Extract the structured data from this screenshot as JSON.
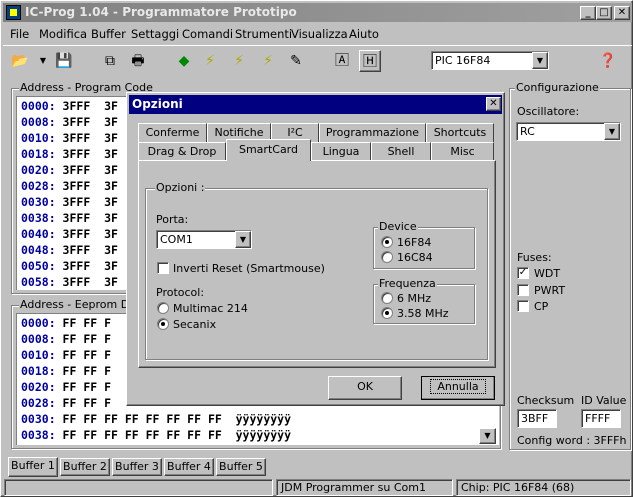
{
  "window": {
    "title": "IC-Prog 1.04 - Programmatore Prototipo"
  },
  "menu": [
    "File",
    "Modifica",
    "Buffer",
    "Settaggi",
    "Comandi",
    "Strumenti",
    "Visualizza",
    "Aiuto"
  ],
  "toolbar": {
    "chip_select": "PIC 16F84"
  },
  "program_panel": {
    "title": "Address - Program Code",
    "rows": [
      {
        "addr": "0000:",
        "val": "3FFF  3F"
      },
      {
        "addr": "0008:",
        "val": "3FFF  3F"
      },
      {
        "addr": "0010:",
        "val": "3FFF  3F"
      },
      {
        "addr": "0018:",
        "val": "3FFF  3F"
      },
      {
        "addr": "0020:",
        "val": "3FFF  3F"
      },
      {
        "addr": "0028:",
        "val": "3FFF  3F"
      },
      {
        "addr": "0030:",
        "val": "3FFF  3F"
      },
      {
        "addr": "0038:",
        "val": "3FFF  3F"
      },
      {
        "addr": "0040:",
        "val": "3FFF  3F"
      },
      {
        "addr": "0048:",
        "val": "3FFF  3F"
      },
      {
        "addr": "0050:",
        "val": "3FFF  3F"
      },
      {
        "addr": "0058:",
        "val": "3FFF  3F"
      }
    ]
  },
  "eeprom_panel": {
    "title": "Address - Eeprom Dat",
    "rows": [
      {
        "addr": "0000:",
        "val": "FF FF F"
      },
      {
        "addr": "0008:",
        "val": "FF FF F"
      },
      {
        "addr": "0010:",
        "val": "FF FF F"
      },
      {
        "addr": "0018:",
        "val": "FF FF F"
      },
      {
        "addr": "0020:",
        "val": "FF FF F"
      },
      {
        "addr": "0028:",
        "val": "FF FF F"
      },
      {
        "addr": "0030:",
        "val": "FF FF FF FF FF FF FF FF  ÿÿÿÿÿÿÿÿ"
      },
      {
        "addr": "0038:",
        "val": "FF FF FF FF FF FF FF FF  ÿÿÿÿÿÿÿÿ"
      }
    ]
  },
  "config": {
    "title": "Configurazione",
    "osc_label": "Oscillatore:",
    "osc_value": "RC",
    "fuses_label": "Fuses:",
    "fuses": [
      {
        "name": "WDT",
        "checked": true
      },
      {
        "name": "PWRT",
        "checked": false
      },
      {
        "name": "CP",
        "checked": false
      }
    ],
    "checksum_label": "Checksum",
    "checksum_value": "3BFF",
    "id_label": "ID Value",
    "id_value": "FFFF",
    "config_word": "Config word : 3FFFh"
  },
  "buffer_tabs": [
    "Buffer 1",
    "Buffer 2",
    "Buffer 3",
    "Buffer 4",
    "Buffer 5"
  ],
  "status": {
    "programmer": "JDM Programmer su Com1",
    "chip": "Chip: PIC 16F84  (68)"
  },
  "dialog": {
    "title": "Opzioni",
    "tabs_row1": [
      "Conferme",
      "Notifiche",
      "I²C",
      "Programmazione",
      "Shortcuts"
    ],
    "tabs_row2": [
      "Drag & Drop",
      "SmartCard",
      "Lingua",
      "Shell",
      "Misc"
    ],
    "group_title": "Opzioni :",
    "porta_label": "Porta:",
    "porta_value": "COM1",
    "invert_reset": "Inverti Reset (Smartmouse)",
    "protocol_label": "Protocol:",
    "protocols": [
      {
        "name": "Multimac 214",
        "on": false
      },
      {
        "name": "Secanix",
        "on": true
      }
    ],
    "device_label": "Device",
    "devices": [
      {
        "name": "16F84",
        "on": true
      },
      {
        "name": "16C84",
        "on": false
      }
    ],
    "freq_label": "Frequenza",
    "freqs": [
      {
        "name": "6 MHz",
        "on": false
      },
      {
        "name": "3.58 MHz",
        "on": true
      }
    ],
    "ok": "OK",
    "cancel": "Annulla"
  }
}
